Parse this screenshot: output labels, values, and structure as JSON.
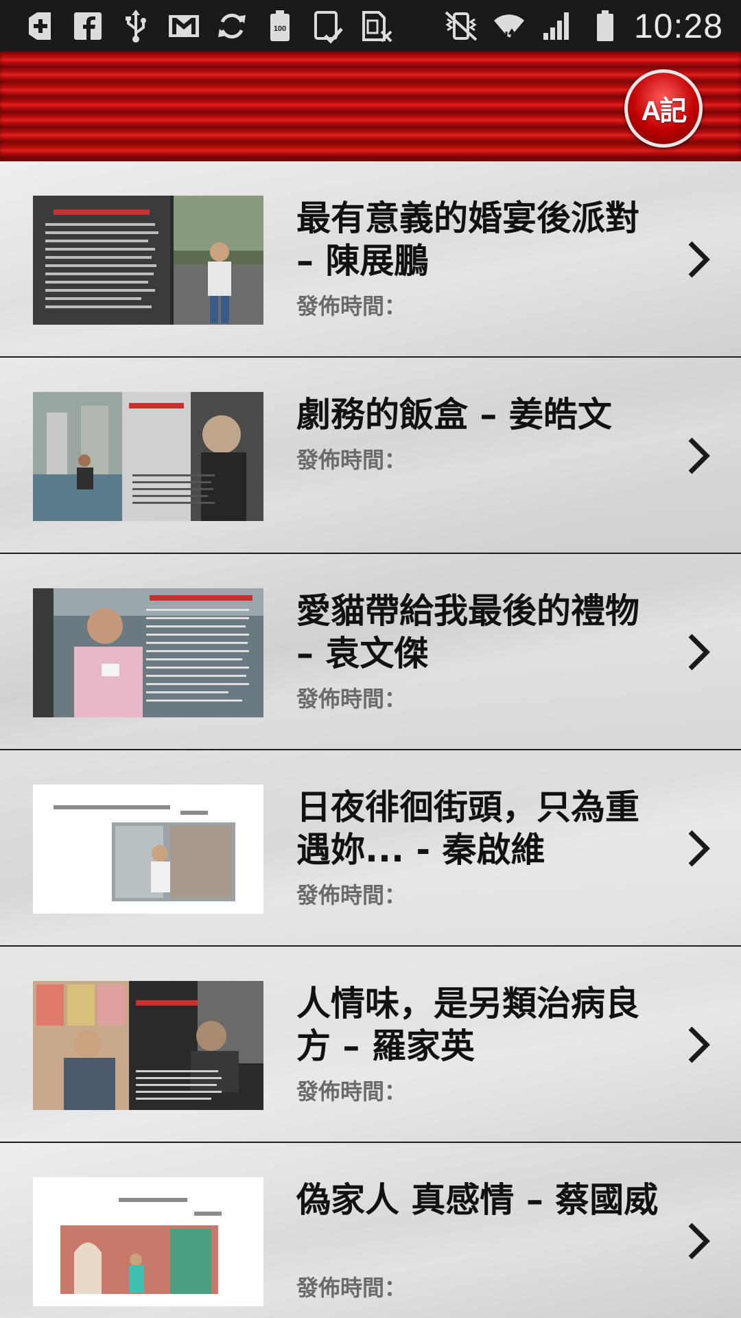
{
  "status_bar": {
    "time": "10:28",
    "icons": [
      "add-box-icon",
      "facebook-icon",
      "usb-icon",
      "gmail-icon",
      "sync-icon",
      "battery-100-icon",
      "tablet-check-icon",
      "sim-card-x-icon",
      "vibrate-mute-icon",
      "wifi-icon",
      "signal-icon",
      "battery-full-icon"
    ],
    "battery_level_label": "100"
  },
  "header": {
    "logo_text": "A記",
    "accent_color": "#c00000"
  },
  "list": {
    "time_label": "發佈時間：",
    "items": [
      {
        "title": "最有意義的婚宴後派對 – 陳展鵬",
        "time": "發佈時間："
      },
      {
        "title": "劇務的飯盒 – 姜皓文",
        "time": "發佈時間："
      },
      {
        "title": "愛貓帶給我最後的禮物 – 袁文傑",
        "time": "發佈時間："
      },
      {
        "title": "日夜徘徊街頭，只為重遇妳... - 秦啟維",
        "time": "發佈時間："
      },
      {
        "title": "人情味，是另類治病良方 – 羅家英",
        "time": "發佈時間："
      },
      {
        "title": "偽家人 真感情 – 蔡國威",
        "time": "發佈時間："
      }
    ]
  }
}
